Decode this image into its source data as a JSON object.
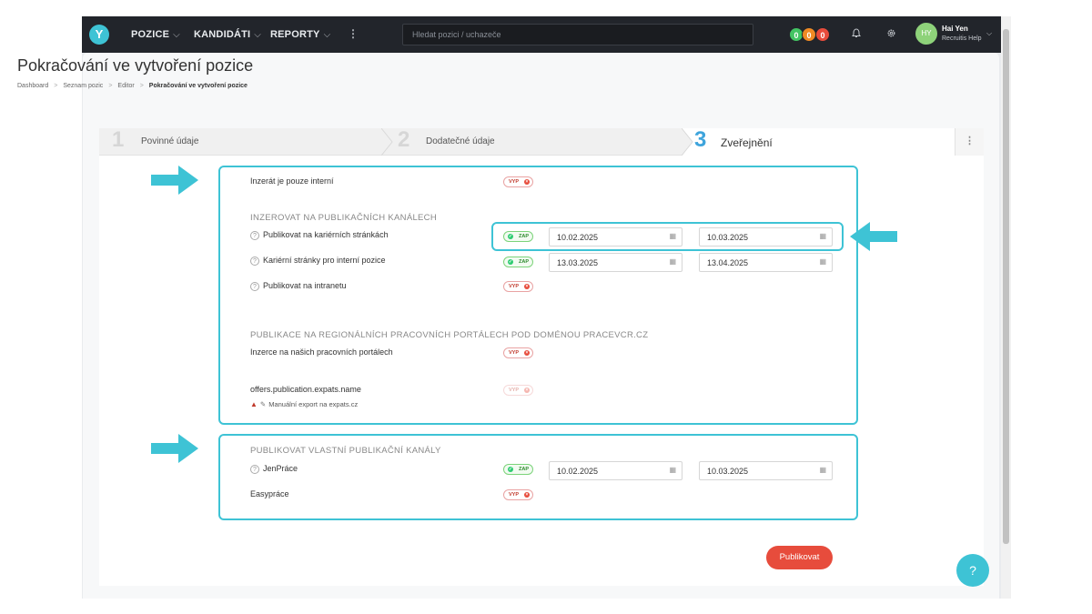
{
  "nav": {
    "logo": "Y",
    "items": [
      {
        "label": "POZICE"
      },
      {
        "label": "KANDIDÁTI"
      },
      {
        "label": "REPORTY"
      }
    ],
    "more": "⋮",
    "search_placeholder": "Hledat pozici / uchazeče",
    "badges": [
      {
        "value": "0",
        "color": "#43c463"
      },
      {
        "value": "0",
        "color": "#f08a24"
      },
      {
        "value": "0",
        "color": "#e74c3c"
      }
    ],
    "user": {
      "initials": "HY",
      "name": "Hai Yen",
      "role": "Recruitis Help"
    }
  },
  "page": {
    "title": "Pokračování ve vytvoření pozice",
    "breadcrumbs": [
      "Dashboard",
      "Seznam pozic",
      "Editor",
      "Pokračování ve vytvoření pozice"
    ]
  },
  "stepper": {
    "steps": [
      {
        "number": "1",
        "label": "Povinné údaje"
      },
      {
        "number": "2",
        "label": "Dodatečné údaje"
      },
      {
        "number": "3",
        "label": "Zveřejnění"
      }
    ],
    "menu": "⋮"
  },
  "form": {
    "internal_only": {
      "label": "Inzerát je pouze interní",
      "toggle": "VYP"
    },
    "channels_heading": "INZEROVAT NA PUBLIKAČNÍCH KANÁLECH",
    "career_pages": {
      "label": "Publikovat na kariérních stránkách",
      "toggle": "ZAP",
      "from": "10.02.2025",
      "to": "10.03.2025"
    },
    "internal_career_pages": {
      "label": "Kariérní stránky pro interní pozice",
      "toggle": "ZAP",
      "from": "13.03.2025",
      "to": "13.04.2025"
    },
    "intranet": {
      "label": "Publikovat na intranetu",
      "toggle": "VYP"
    },
    "regional_heading": "PUBLIKACE NA REGIONÁLNÍCH PRACOVNÍCH PORTÁLECH POD DOMÉNOU PRACEVCR.CZ",
    "our_portals": {
      "label": "Inzerce na našich pracovních portálech",
      "toggle": "VYP"
    },
    "expats": {
      "label": "offers.publication.expats.name",
      "toggle": "VYP",
      "warning": "Manuální export na expats.cz"
    },
    "own_heading": "PUBLIKOVAT VLASTNÍ PUBLIKAČNÍ KANÁLY",
    "jenprace": {
      "label": "JenPráce",
      "toggle": "ZAP",
      "from": "10.02.2025",
      "to": "10.03.2025"
    },
    "easyprace": {
      "label": "Easypráce",
      "toggle": "VYP"
    }
  },
  "actions": {
    "publish": "Publikovat",
    "help": "?"
  },
  "colors": {
    "accent": "#3ec3d5",
    "publish": "#e74c3c",
    "active_step": "#3ea4dc"
  }
}
